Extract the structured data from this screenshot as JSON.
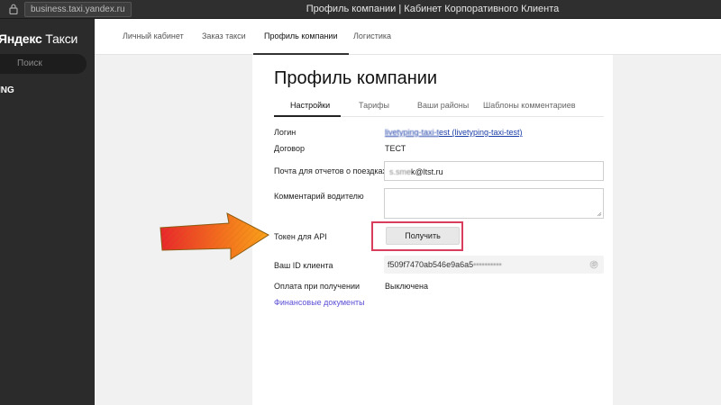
{
  "browser": {
    "url": "business.taxi.yandex.ru",
    "window_title": "Профиль компании | Кабинет Корпоративного Клиента"
  },
  "sidebar": {
    "logo_bold": "Яндекс",
    "logo_regular": " Такси",
    "search_placeholder": "Поиск",
    "org_name": "ING"
  },
  "topnav": {
    "tabs": [
      {
        "label": "Личный кабинет",
        "active": false
      },
      {
        "label": "Заказ такси",
        "active": false
      },
      {
        "label": "Профиль компании",
        "active": true
      },
      {
        "label": "Логистика",
        "active": false
      }
    ]
  },
  "page": {
    "title": "Профиль компании",
    "subtabs": [
      {
        "label": "Настройки",
        "active": true
      },
      {
        "label": "Тарифы",
        "active": false
      },
      {
        "label": "Ваши районы",
        "active": false
      },
      {
        "label": "Шаблоны комментариев",
        "active": false
      }
    ]
  },
  "form": {
    "login_label": "Логин",
    "login_value_masked": "livetyping-taxi-t",
    "login_value_link": "est (livetyping-taxi-test)",
    "contract_label": "Договор",
    "contract_value": "ТЕСТ",
    "report_email_label": "Почта для отчетов о поездках",
    "report_email_masked": "s.sme",
    "report_email_visible": "k@ltst.ru",
    "driver_comment_label": "Комментарий водителю",
    "driver_comment_value": "",
    "api_token_label": "Токен для API",
    "get_button_label": "Получить",
    "client_id_label": "Ваш ID клиента",
    "client_id_visible": "f509f7470ab546e9a6a5",
    "client_id_masked": "••••••••••",
    "payment_label": "Оплата при получении",
    "payment_value": "Выключена",
    "finance_docs_link": "Финансовые документы"
  },
  "colors": {
    "highlight_border": "#d83d5c",
    "arrow_fill_start": "#e8262c",
    "arrow_fill_end": "#f9a21a",
    "sidebar_bg": "#2b2b2b"
  },
  "icons": [
    "lock-icon",
    "copy-icon",
    "resize-grip-icon",
    "annotation-arrow"
  ]
}
